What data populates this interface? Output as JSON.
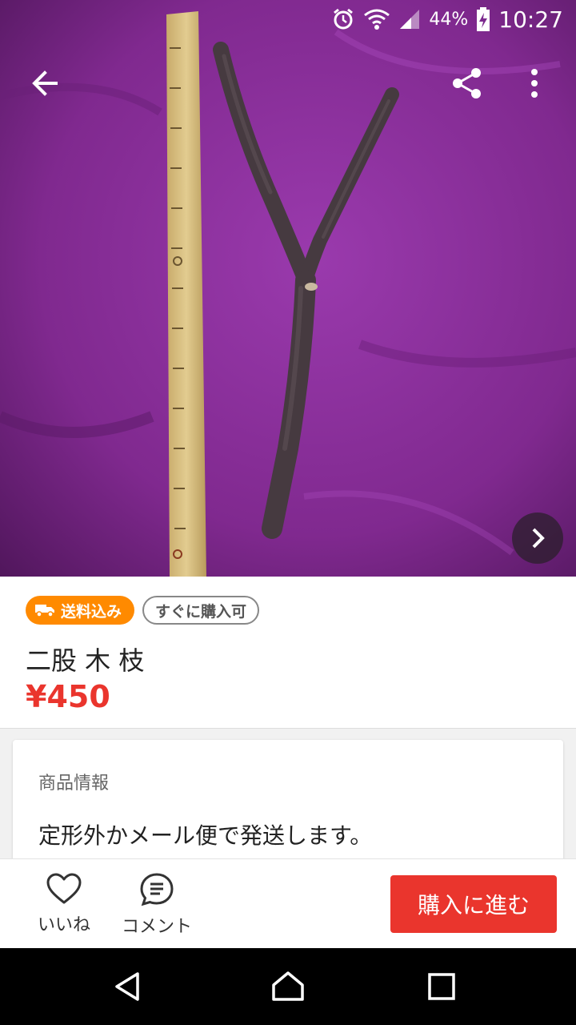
{
  "status_bar": {
    "battery": "44%",
    "time": "10:27"
  },
  "hero": {
    "photo_background": "#7c2a8e"
  },
  "badges": {
    "shipping": "送料込み",
    "instant_buy": "すぐに購入可"
  },
  "item": {
    "title": "二股 木 枝",
    "price": "¥450"
  },
  "info": {
    "heading": "商品情報",
    "body": "定形外かメール便で発送します。"
  },
  "actions": {
    "like": "いいね",
    "comment": "コメント",
    "buy": "購入に進む"
  },
  "colors": {
    "accent_red": "#ea352d",
    "badge_orange": "#ff8a00"
  }
}
